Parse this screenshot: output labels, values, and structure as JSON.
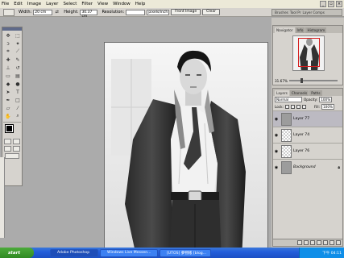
{
  "menubar": {
    "items": [
      "File",
      "Edit",
      "Image",
      "Layer",
      "Select",
      "Filter",
      "View",
      "Window",
      "Help"
    ]
  },
  "options": {
    "width_label": "Width:",
    "width_value": "20 cm",
    "height_label": "Height:",
    "height_value": "30.37 cm",
    "resolution_label": "Resolution:",
    "resolution_value": "",
    "resolution_unit": "pixels/inch",
    "front_image_label": "Front Image",
    "clear_label": "Clear",
    "well_tabs": [
      "Brushes",
      "Tool Pr",
      "Layer Comps"
    ]
  },
  "navigator": {
    "tabs": [
      "Navigator",
      "Info",
      "Histogram"
    ],
    "zoom": "31.67%"
  },
  "layers": {
    "tabs": [
      "Layers",
      "Channels",
      "Paths"
    ],
    "blend_mode": "Normal",
    "opacity_label": "Opacity:",
    "opacity_value": "100%",
    "lock_label": "Lock:",
    "fill_label": "Fill:",
    "fill_value": "100%",
    "items": [
      {
        "name": "Layer 77",
        "selected": true
      },
      {
        "name": "Layer 74",
        "selected": false
      },
      {
        "name": "Layer 76",
        "selected": false
      },
      {
        "name": "Background",
        "selected": false
      }
    ]
  },
  "toolbox": {
    "tools": [
      "move",
      "marquee",
      "lasso",
      "magic-wand",
      "crop",
      "slice",
      "healing",
      "brush",
      "stamp",
      "history-brush",
      "eraser",
      "gradient",
      "blur",
      "dodge",
      "path-select",
      "type",
      "pen",
      "shape",
      "notes",
      "eyedropper",
      "hand",
      "zoom"
    ],
    "foreground_color": "#000000",
    "background_color": "#c31414"
  },
  "taskbar": {
    "start_label": "start",
    "tasks": [
      "Adobe Photoshop",
      "Windows Live Messen...",
      "[UTOS] 夢物帳 [blog..."
    ],
    "clock": "下午 04:11"
  }
}
